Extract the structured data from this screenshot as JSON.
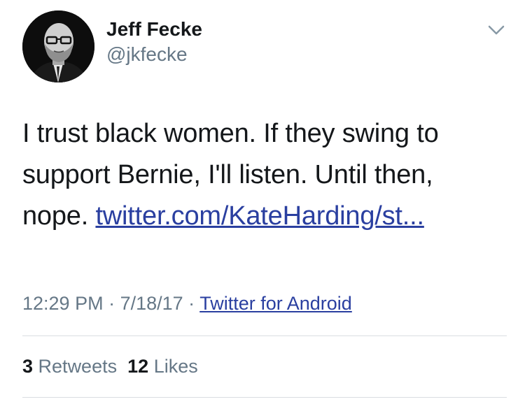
{
  "author": {
    "name": "Jeff Fecke",
    "handle": "@jkfecke",
    "avatar_icon": "profile-photo"
  },
  "menu_icon": "chevron-down-icon",
  "tweet": {
    "text": "I trust black women. If they swing to support Bernie, I'll listen. Until then, nope. ",
    "link_text": "twitter.com/KateHarding/st..."
  },
  "meta": {
    "time": "12:29 PM",
    "separator": " · ",
    "date": "7/18/17",
    "source": "Twitter for Android"
  },
  "stats": {
    "retweets_count": "3",
    "retweets_label": "Retweets",
    "likes_count": "12",
    "likes_label": "Likes"
  },
  "colors": {
    "link": "#2a3fa0",
    "muted": "#657786",
    "text": "#14171a",
    "divider": "#d9dde1"
  }
}
